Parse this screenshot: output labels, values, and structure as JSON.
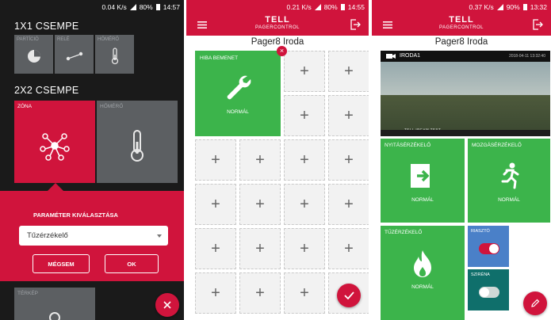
{
  "panel1": {
    "status": {
      "speed": "0.04 K/s",
      "battery": "80%",
      "time": "14:57"
    },
    "section_1x1": "1X1 CSEMPE",
    "tiles_1x1": [
      {
        "label": "PARTÍCIÓ",
        "icon": "pie-chart-icon"
      },
      {
        "label": "RELÉ",
        "icon": "relay-icon"
      },
      {
        "label": "HŐMÉRŐ",
        "icon": "thermometer-icon"
      }
    ],
    "section_2x2": "2X2 CSEMPE",
    "tiles_2x2": [
      {
        "label": "ZÓNA",
        "icon": "zone-network-icon",
        "color": "#d0143c"
      },
      {
        "label": "HŐMÉRŐ",
        "icon": "thermometer-icon",
        "color": "#5c5f62"
      }
    ],
    "dialog": {
      "title": "PARAMÉTER KIVÁLASZTÁSA",
      "selected": "Tűzérzékelő",
      "cancel": "MÉGSEM",
      "ok": "OK"
    },
    "map_tile_label": "TÉRKÉP"
  },
  "panel2": {
    "status": {
      "speed": "0.21 K/s",
      "battery": "80%",
      "time": "14:55"
    },
    "logo_top": "TELL",
    "logo_bottom": "PAGERCONTROL",
    "title": "Pager8 Iroda",
    "big_tile": {
      "label": "HIBA BEMENET",
      "state": "NORMÁL",
      "icon": "wrench-icon",
      "color": "#3cb44b"
    },
    "add_glyph": "+",
    "remove_glyph": "×"
  },
  "panel3": {
    "status": {
      "speed": "0.37 K/s",
      "battery": "90%",
      "time": "13:32"
    },
    "logo_top": "TELL",
    "logo_bottom": "PAGERCONTROL",
    "title": "Pager8 Iroda",
    "camera": {
      "name": "IRODA1",
      "timestamp": "2018-04-11 13:32:40",
      "watermark": "TELL IPCAM TEST"
    },
    "tiles": [
      {
        "label": "NYITÁSÉRZÉKELŐ",
        "state": "NORMÁL",
        "icon": "door-exit-icon"
      },
      {
        "label": "MOZGÁSÉRZÉKELŐ",
        "state": "NORMÁL",
        "icon": "running-person-icon"
      },
      {
        "label": "TŰZÉRZÉKELŐ",
        "state": "NORMÁL",
        "icon": "fire-icon"
      }
    ],
    "switches": [
      {
        "label": "RIASZTÓ",
        "on": true,
        "color": "#4a80c8"
      },
      {
        "label": "SZIRÉNA",
        "on": false,
        "color": "#0f6f6b"
      }
    ]
  }
}
